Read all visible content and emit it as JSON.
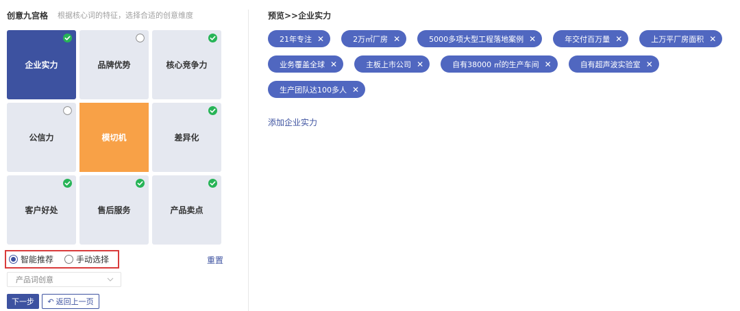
{
  "header": {
    "title": "创意九宫格",
    "description": "根据核心词的特征，选择合适的创意维度"
  },
  "grid": {
    "cells": [
      {
        "label": "企业实力",
        "state": "checked",
        "active": true
      },
      {
        "label": "品牌优势",
        "state": "unchecked"
      },
      {
        "label": "核心竞争力",
        "state": "checked"
      },
      {
        "label": "公信力",
        "state": "unchecked"
      },
      {
        "label": "模切机",
        "state": "none",
        "keyword": true
      },
      {
        "label": "差异化",
        "state": "checked"
      },
      {
        "label": "客户好处",
        "state": "checked"
      },
      {
        "label": "售后服务",
        "state": "checked"
      },
      {
        "label": "产品卖点",
        "state": "checked"
      }
    ]
  },
  "mode": {
    "smart_label": "智能推荐",
    "manual_label": "手动选择",
    "selected": "smart"
  },
  "reset_label": "重置",
  "select": {
    "value": "产品词创意"
  },
  "buttons": {
    "next_label": "下一步",
    "back_label": "返回上一页"
  },
  "preview": {
    "title": "预览>>企业实力",
    "tags": [
      "21年专注",
      "2万㎡厂房",
      "5000多项大型工程落地案例",
      "年交付百万量",
      "上万平厂房面积",
      "业务覆盖全球",
      "主板上市公司",
      "自有38000 ㎡的生产车间",
      "自有超声波实验室",
      "生产团队达100多人"
    ],
    "add_label": "添加企业实力"
  },
  "colors": {
    "primary": "#3d52a0",
    "tag_bg": "#5067c0",
    "cell_bg": "#e5e8f0",
    "keyword_bg": "#f8a147",
    "check_green": "#27b457",
    "highlight_border": "#d93a3a"
  },
  "icons": {
    "checked": "check-circle-icon",
    "unchecked": "empty-circle-icon",
    "tag_close": "close-icon",
    "select": "chevron-down-icon",
    "back": "undo-arrow-icon"
  }
}
